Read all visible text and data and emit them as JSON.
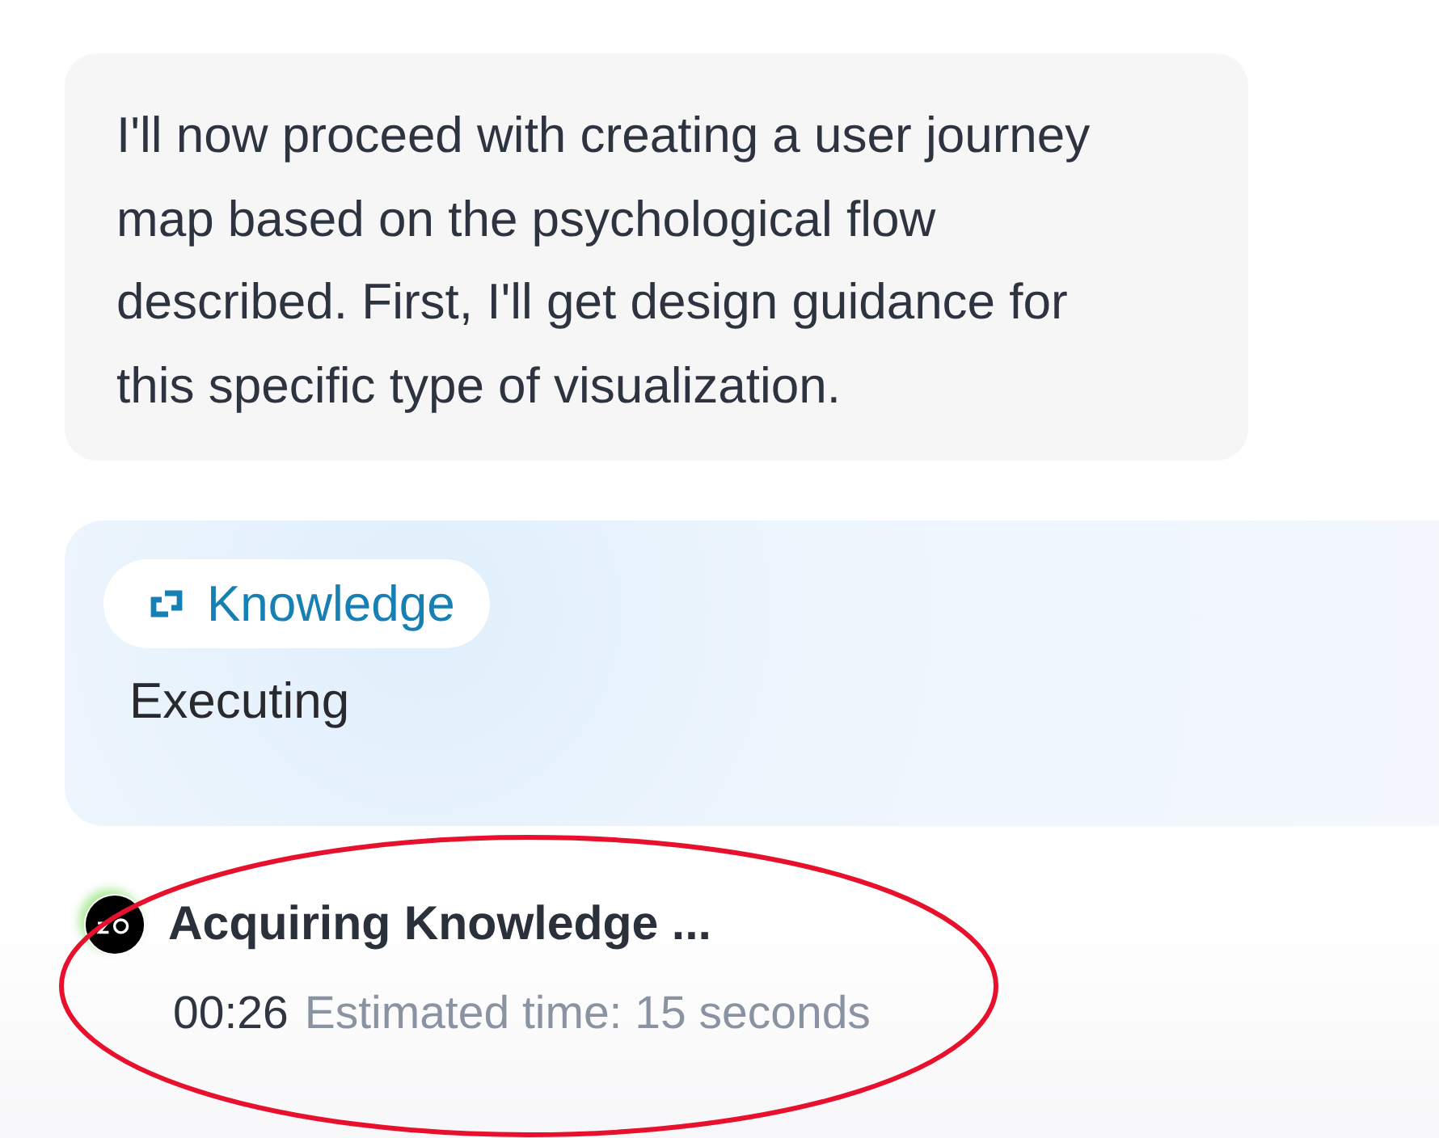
{
  "message": {
    "text": "I'll now proceed with creating a user journey map based on the psychological flow described. First, I'll get design guidance for this specific type of visualization."
  },
  "tool_card": {
    "tag": {
      "label": "Knowledge"
    },
    "status": "Executing"
  },
  "progress": {
    "title": "Acquiring Knowledge ...",
    "elapsed": "00:26",
    "estimate": "Estimated time: 15 seconds"
  },
  "annotation": {
    "kind": "ellipse"
  }
}
